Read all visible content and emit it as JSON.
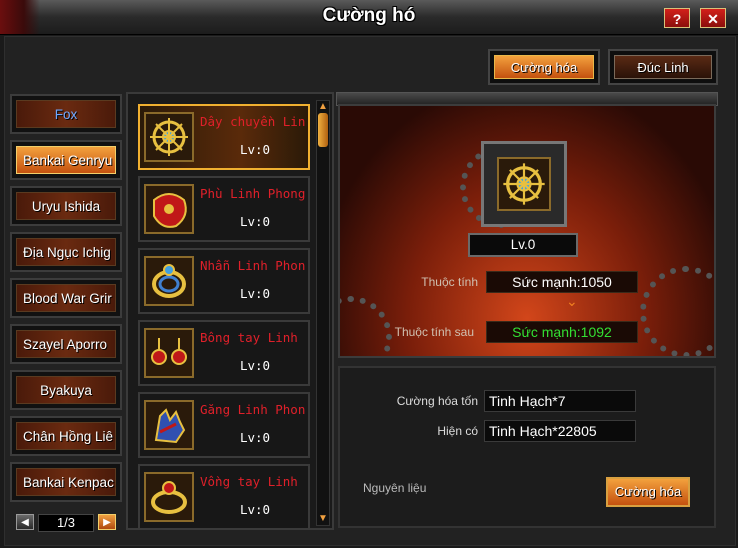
{
  "window": {
    "title": "Cường hó"
  },
  "titlebar": {
    "help_label": "?",
    "close_label": "✕"
  },
  "tabs": [
    {
      "label": "Cường hóa",
      "active": true
    },
    {
      "label": "Đúc Linh",
      "active": false
    }
  ],
  "characters": [
    {
      "label": "Fox"
    },
    {
      "label": "Bankai Genryu"
    },
    {
      "label": "Uryu Ishida"
    },
    {
      "label": "Địa Ngục Ichig"
    },
    {
      "label": "Blood War Grir"
    },
    {
      "label": "Szayel Aporro"
    },
    {
      "label": "Byakuya"
    },
    {
      "label": "Chân Hồng Liê"
    },
    {
      "label": "Bankai Kenpac"
    }
  ],
  "pager": {
    "text": "1/3",
    "prev": "◀",
    "next": "▶"
  },
  "items": [
    {
      "name": "Dây chuyền Lin",
      "level": "Lv:0"
    },
    {
      "name": "Phù Linh Phong",
      "level": "Lv:0"
    },
    {
      "name": "Nhẫn Linh Phon",
      "level": "Lv:0"
    },
    {
      "name": "Bông tay Linh",
      "level": "Lv:0"
    },
    {
      "name": "Găng Linh Phon",
      "level": "Lv:0"
    },
    {
      "name": "Vồng tay Linh",
      "level": "Lv:0"
    }
  ],
  "detail": {
    "level": "Lv.0",
    "attr_label": "Thuộc tính",
    "attr_value": "Sức mạnh:1050",
    "attr_after_label": "Thuộc tính sau",
    "attr_after_value": "Sức mạnh:1092",
    "cost_label": "Cường hóa tốn",
    "cost_value": "Tinh Hạch*7",
    "have_label": "Hiện có",
    "have_value": "Tinh Hạch*22805",
    "material_label": "Nguyên liệu",
    "action_label": "Cường hóa"
  },
  "colors": {
    "accent": "#e8862a",
    "item_name": "#e0202a",
    "after_value": "#33e033",
    "current_value": "#ffffff"
  },
  "icons": [
    "amulet-icon",
    "talisman-icon",
    "ring-icon",
    "earring-icon",
    "glove-icon",
    "bracelet-icon"
  ]
}
